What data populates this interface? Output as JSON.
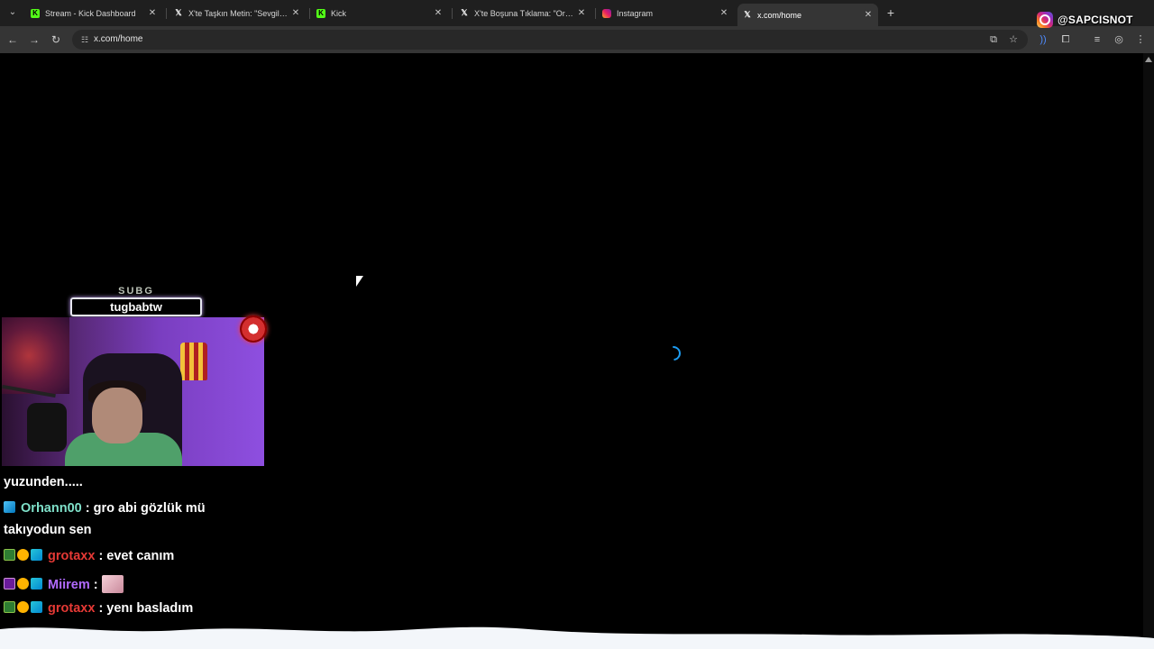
{
  "tabs": [
    {
      "title": "Stream - Kick Dashboard",
      "favicon": "kick-icon"
    },
    {
      "title": "X'te Taşkın Metin: \"Sevgili Galat",
      "favicon": "x-icon"
    },
    {
      "title": "Kick",
      "favicon": "kick-icon"
    },
    {
      "title": "X'te Boşuna Tıklama: \"Orkun Iş",
      "favicon": "x-icon"
    },
    {
      "title": "Instagram",
      "favicon": "instagram-icon"
    },
    {
      "title": "x.com/home",
      "favicon": "x-icon",
      "active": true
    }
  ],
  "address_bar": {
    "url": "x.com/home"
  },
  "watermark": {
    "handle": "@SAPCISNOT"
  },
  "overlay": {
    "sub_label": "SUBG",
    "sub_name": "tugbabtw"
  },
  "chat": {
    "messages": [
      {
        "user": "",
        "text": "yuzunden.....",
        "color": "#ffffff"
      },
      {
        "user": "Orhann00",
        "text": " : gro abi gözlük mü",
        "text2": "takıyodun sen",
        "color": "#7fe0c9"
      },
      {
        "user": "grotaxx",
        "text": " : evet canım",
        "color": "#e53935"
      },
      {
        "user": "Miirem",
        "text": " : ",
        "color": "#b26bff"
      },
      {
        "user": "grotaxx",
        "text": " : yenı basladım",
        "color": "#e53935"
      }
    ]
  },
  "colors": {
    "spinner": "#1d9bf0",
    "kick_green": "#53fc18"
  }
}
